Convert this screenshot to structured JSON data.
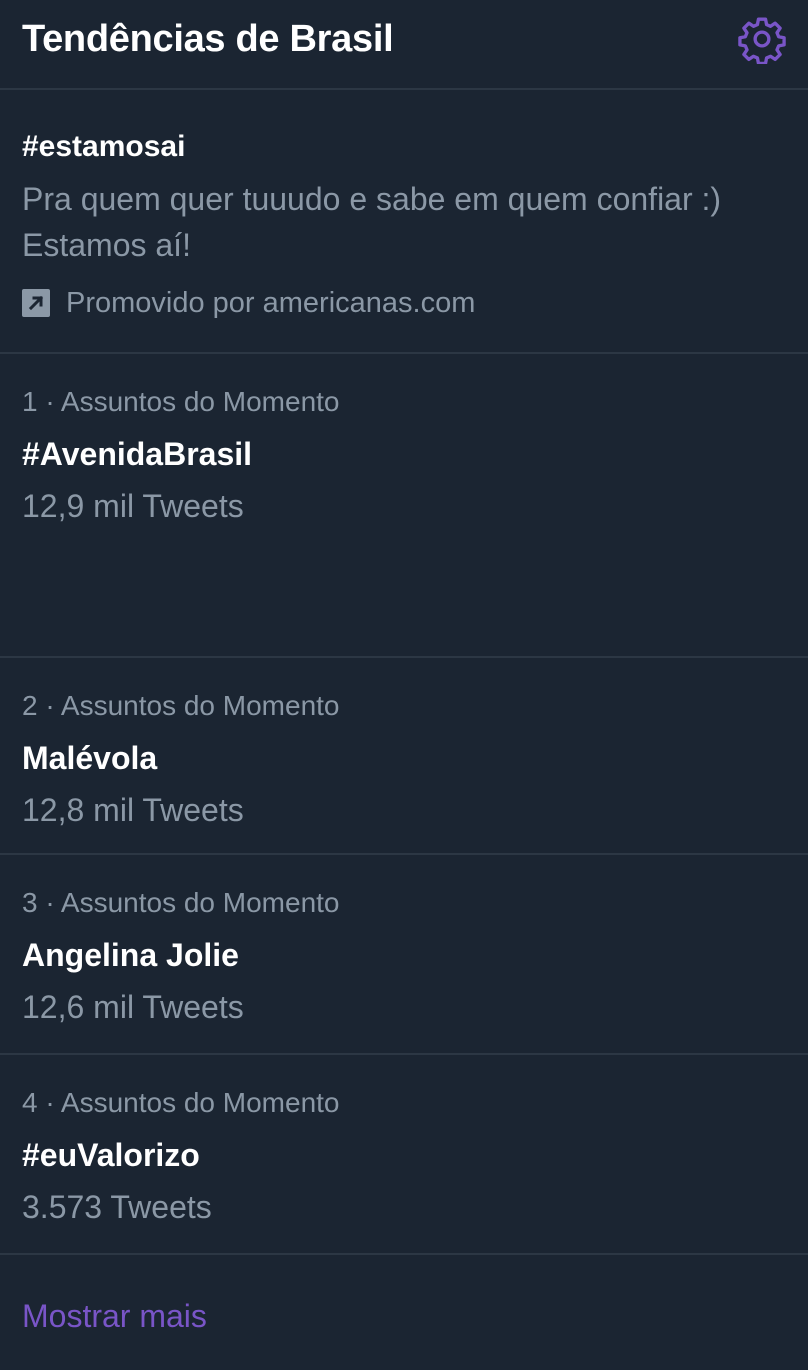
{
  "header": {
    "title": "Tendências de Brasil",
    "settings_icon": "gear-icon",
    "accent_color": "#7955c7"
  },
  "promoted": {
    "hashtag": "#estamosai",
    "description": "Pra quem quer tuuudo e sabe em quem confiar :) Estamos aí!",
    "promoted_by": "Promovido por americanas.com",
    "icon": "promoted-arrow-icon"
  },
  "trends": [
    {
      "meta": "1 · Assuntos do Momento",
      "name": "#AvenidaBrasil",
      "count": "12,9 mil Tweets"
    },
    {
      "meta": "2 · Assuntos do Momento",
      "name": "Malévola",
      "count": "12,8 mil Tweets"
    },
    {
      "meta": "3 · Assuntos do Momento",
      "name": "Angelina Jolie",
      "count": "12,6 mil Tweets"
    },
    {
      "meta": "4 · Assuntos do Momento",
      "name": "#euValorizo",
      "count": "3.573 Tweets"
    }
  ],
  "footer": {
    "show_more": "Mostrar mais"
  }
}
